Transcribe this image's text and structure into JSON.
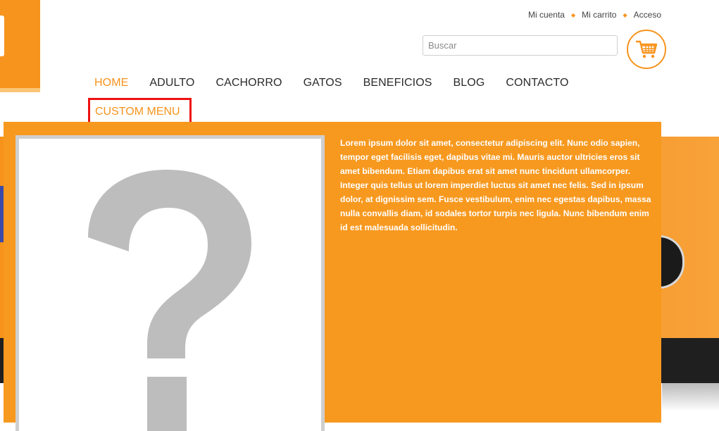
{
  "header": {
    "links": [
      {
        "label": "Mi cuenta"
      },
      {
        "label": "Mi carrito"
      },
      {
        "label": "Acceso"
      }
    ],
    "separator": "◆",
    "search": {
      "placeholder": "Buscar",
      "value": ""
    },
    "cart_icon": "shopping-cart-icon"
  },
  "nav": {
    "items": [
      {
        "label": "HOME",
        "active": true
      },
      {
        "label": "ADULTO"
      },
      {
        "label": "CACHORRO"
      },
      {
        "label": "GATOS"
      },
      {
        "label": "BENEFICIOS"
      },
      {
        "label": "BLOG"
      },
      {
        "label": "CONTACTO"
      }
    ],
    "custom_menu": "CUSTOM MENU"
  },
  "dropdown": {
    "image_icon": "question-mark-placeholder-icon",
    "text": "Lorem ipsum dolor sit amet, consectetur adipiscing elit. Nunc odio sapien, tempor eget facilisis eget, dapibus vitae mi. Mauris auctor ultricies eros sit amet bibendum. Etiam dapibus erat sit amet nunc tincidunt ullamcorper. Integer quis tellus ut lorem imperdiet luctus sit amet nec felis. Sed in ipsum dolor, at dignissim sem. Fusce vestibulum, enim nec egestas dapibus, massa nulla convallis diam, id sodales tortor turpis nec ligula. Nunc bibendum enim id est malesuada sollicitudin."
  },
  "colors": {
    "accent": "#f7941d",
    "highlight_border": "#ee1111",
    "panel": "#f7991f"
  }
}
